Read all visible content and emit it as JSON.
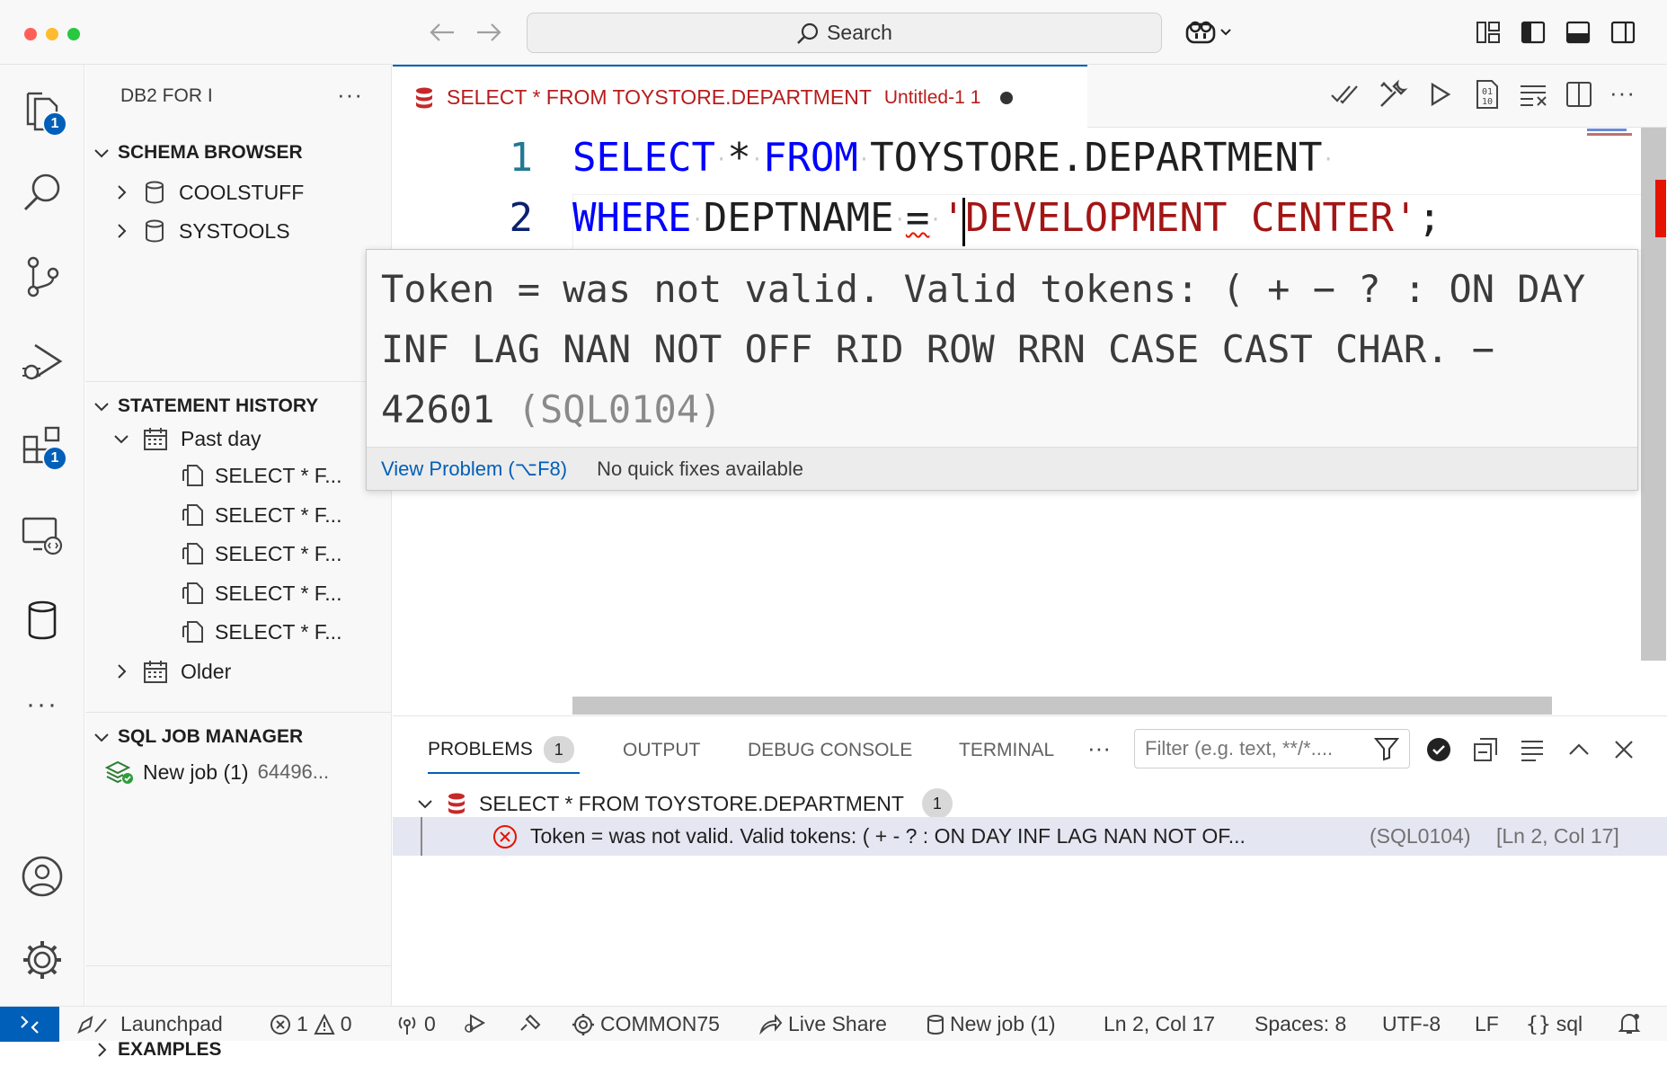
{
  "titlebar": {
    "search_label": "Search"
  },
  "activity_badges": {
    "explorer": "1",
    "extensions": "1"
  },
  "sidebar": {
    "title": "DB2 FOR I",
    "schema_browser": {
      "title": "SCHEMA BROWSER",
      "items": [
        "COOLSTUFF",
        "SYSTOOLS"
      ]
    },
    "statement_history": {
      "title": "STATEMENT HISTORY",
      "past_day": "Past day",
      "statements": [
        "SELECT * F...",
        "SELECT * F...",
        "SELECT * F...",
        "SELECT * F...",
        "SELECT * F..."
      ],
      "older": "Older"
    },
    "sql_job_manager": {
      "title": "SQL JOB MANAGER",
      "job_name": "New job (1)",
      "job_id": "64496..."
    },
    "examples": {
      "title": "EXAMPLES"
    }
  },
  "editor": {
    "tab_title": "SELECT * FROM TOYSTORE.DEPARTMENT",
    "tab_subtitle": "Untitled-1",
    "tab_problems": "1",
    "line_numbers": [
      "1",
      "2"
    ],
    "line1": {
      "kw1": "SELECT",
      "star": "*",
      "kw2": "FROM",
      "table": "TOYSTORE.DEPARTMENT"
    },
    "line2": {
      "kw1": "WHERE",
      "column": "DEPTNAME",
      "op": "=",
      "value": "'DEVELOPMENT CENTER'",
      "end": ";"
    },
    "hover": {
      "message": "Token = was not valid. Valid tokens: ( + − ? : ON DAY INF LAG NAN NOT OFF RID ROW RRN CASE CAST CHAR. − 42601",
      "code": "(SQL0104)",
      "view_problem": "View Problem (⌥F8)",
      "no_fixes": "No quick fixes available"
    }
  },
  "panel": {
    "tabs": {
      "problems": "PROBLEMS",
      "problems_count": "1",
      "output": "OUTPUT",
      "debug_console": "DEBUG CONSOLE",
      "terminal": "TERMINAL"
    },
    "filter_placeholder": "Filter (e.g. text, **/*....",
    "file_entry": "SELECT * FROM TOYSTORE.DEPARTMENT",
    "file_count": "1",
    "problem": {
      "message": "Token = was not valid. Valid tokens: ( + - ? : ON DAY INF LAG NAN NOT OF...",
      "code": "(SQL0104)",
      "location": "[Ln 2, Col 17]"
    }
  },
  "statusbar": {
    "launchpad": "Launchpad",
    "errors": "1",
    "warnings": "0",
    "ports": "0",
    "connection": "COMMON75",
    "live_share": "Live Share",
    "job": "New job (1)",
    "cursor": "Ln 2, Col 17",
    "spaces": "Spaces: 8",
    "encoding": "UTF-8",
    "eol": "LF",
    "language": "sql"
  },
  "colors": {
    "accent": "#005fb8",
    "keyword": "#0000ff",
    "string": "#a31515",
    "error": "#e51400",
    "tab_text": "#b91c1c"
  }
}
